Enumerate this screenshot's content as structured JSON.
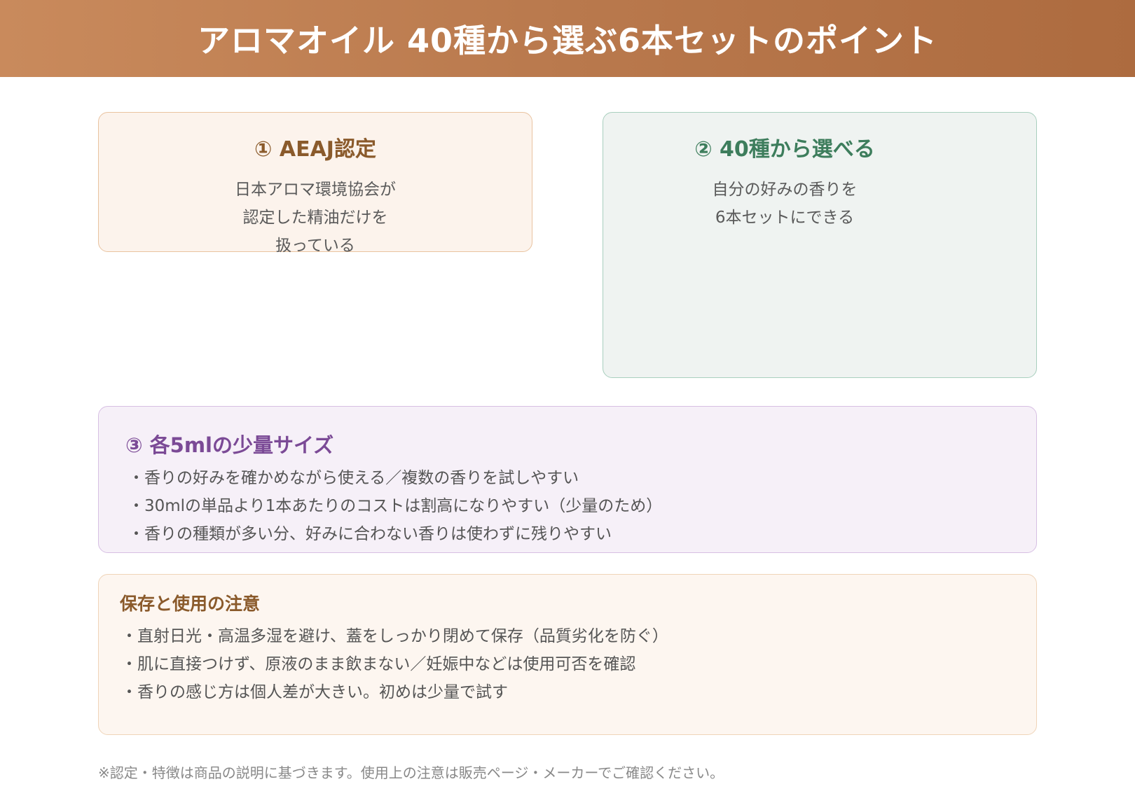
{
  "header": {
    "title": "アロマオイル 40種から選ぶ6本セットのポイント"
  },
  "point1": {
    "title": "① AEAJ認定",
    "lines": [
      "日本アロマ環境協会が",
      "認定した精油だけを",
      "扱っている"
    ]
  },
  "point2": {
    "title": "② 40種から選べる",
    "lines": [
      "自分の好みの香りを",
      "6本セットにできる"
    ]
  },
  "point3": {
    "title": "③ 各5mlの少量サイズ",
    "items": [
      "・香りの好みを確かめながら使える／複数の香りを試しやすい",
      "・30mlの単品より1本あたりのコストは割高になりやすい（少量のため）",
      "・香りの種類が多い分、好みに合わない香りは使わずに残りやすい"
    ]
  },
  "caution": {
    "title": "保存と使用の注意",
    "items": [
      "・直射日光・高温多湿を避け、蓋をしっかり閉めて保存（品質劣化を防ぐ）",
      "・肌に直接つけず、原液のまま飲まない／妊娠中などは使用可否を確認",
      "・香りの感じ方は個人差が大きい。初めは少量で試す"
    ]
  },
  "footnote": "※認定・特徴は商品の説明に基づきます。使用上の注意は販売ページ・メーカーでご確認ください。",
  "colors": {
    "banner": "#b9794d",
    "point1_accent": "#8a5a2b",
    "point2_accent": "#3d7d5c",
    "point3_accent": "#7b4a96"
  }
}
